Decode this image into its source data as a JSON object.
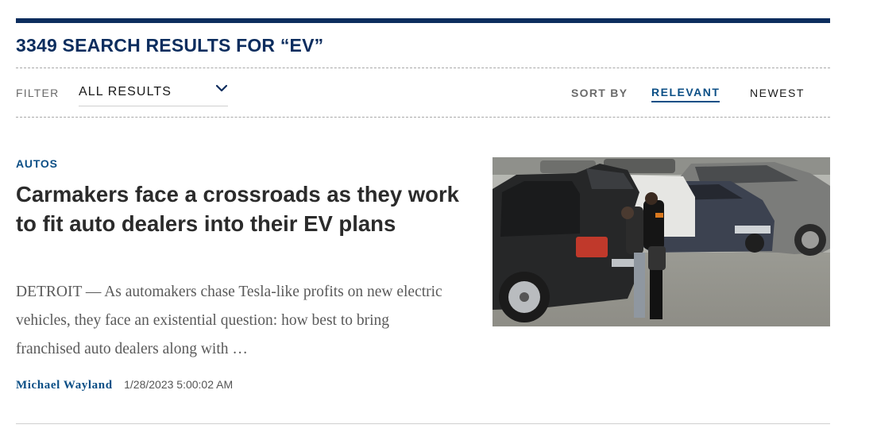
{
  "header": {
    "results_title": "3349 SEARCH RESULTS FOR “EV”",
    "accent_color": "#0c2d5e"
  },
  "filter": {
    "label": "FILTER",
    "selected": "ALL RESULTS",
    "icon": "chevron-down-icon"
  },
  "sort": {
    "label": "SORT BY",
    "options": [
      "RELEVANT",
      "NEWEST"
    ],
    "active": "RELEVANT",
    "active_color": "#0c4f86"
  },
  "results": [
    {
      "category": "AUTOS",
      "headline": "Carmakers face a crossroads as they work to fit auto dealers into their EV plans",
      "summary": "DETROIT — As automakers chase Tesla-like profits on new electric vehicles, they face an existential question: how best to bring franchised auto dealers along with …",
      "author": "Michael Wayland",
      "timestamp": "1/28/2023 5:00:02 AM",
      "image": "car-dealer-lot-photo"
    }
  ]
}
